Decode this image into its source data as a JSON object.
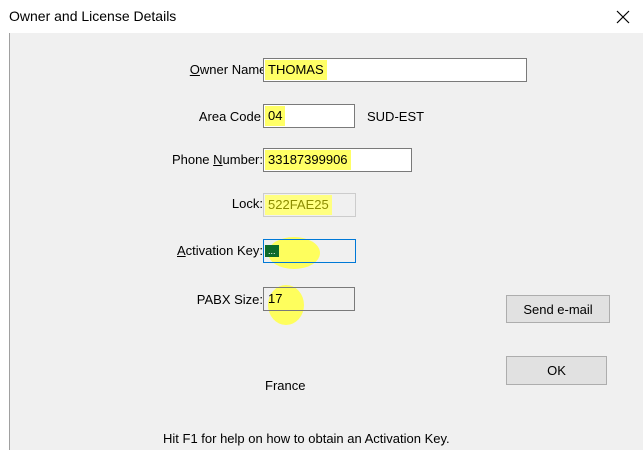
{
  "window": {
    "title": "Owner and License Details",
    "close_icon": "close-icon"
  },
  "form": {
    "owner_name": {
      "label_accel": "O",
      "label_rest": "wner Name:",
      "value": "THOMAS"
    },
    "area_code": {
      "label": "Area Code",
      "value": "04",
      "region": "SUD-EST"
    },
    "phone_number": {
      "label_pre": "Phone ",
      "label_accel": "N",
      "label_rest": "umber:",
      "value": "33187399906"
    },
    "lock": {
      "label": "Lock:",
      "value": "522FAE25"
    },
    "activation_key": {
      "label_accel": "A",
      "label_rest": "ctivation Key:",
      "value": "..."
    },
    "pabx_size": {
      "label": "PABX Size:",
      "value": "17"
    }
  },
  "buttons": {
    "send_email": "Send e-mail",
    "ok": "OK"
  },
  "country": "France",
  "help_text": "Hit F1 for help on how to obtain an Activation Key.",
  "colors": {
    "highlight": "#ffff66",
    "focus_border": "#0078d7",
    "dialog_bg": "#f0f0f0"
  }
}
